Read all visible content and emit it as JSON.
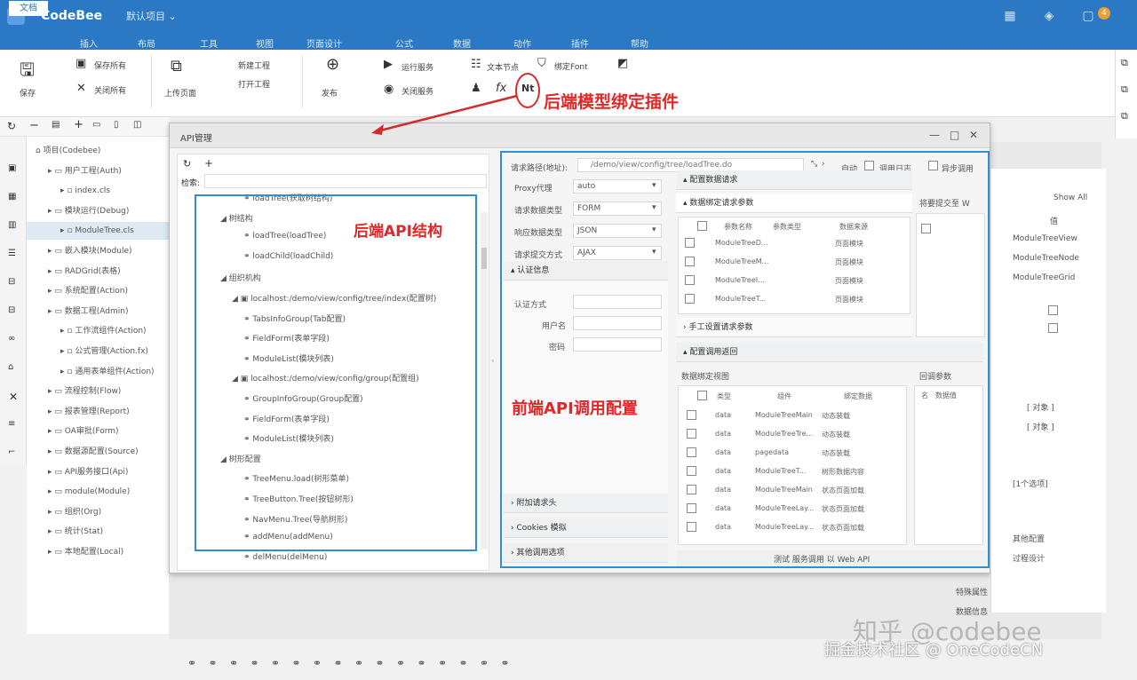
{
  "window": {
    "title": "CodeBee",
    "file_tab": "默认项目 ⌄",
    "notification_count": "4"
  },
  "menu": [
    "文档",
    "插入",
    "布局",
    "工具",
    "视图",
    "页面设计",
    "公式",
    "数据",
    "动作",
    "插件",
    "帮助"
  ],
  "ribbon": {
    "save": "保存",
    "save_all": "保存所有",
    "close_all": "关闭所有",
    "upload": "上传页面",
    "new_project": "新建工程",
    "open_project": "打开工程",
    "publish": "发布",
    "run": "运行服务",
    "close_service": "关闭服务",
    "text_node": "文本节点",
    "binding_font": "绑定Font",
    "plugin_tag": "Nt"
  },
  "tree": {
    "items": [
      {
        "label": "项目(Codebee)",
        "icon": "home-icon",
        "indent": 0
      },
      {
        "label": "用户工程(Auth)",
        "icon": "user-icon",
        "indent": 1
      },
      {
        "label": "index.cls",
        "icon": "file-icon",
        "indent": 2
      },
      {
        "label": "模块运行(Debug)",
        "icon": "folder-icon",
        "indent": 1
      },
      {
        "label": "ModuleTree.cls",
        "icon": "file-icon",
        "indent": 2,
        "selected": true
      },
      {
        "label": "嵌入模块(Module)",
        "icon": "grid-icon",
        "indent": 1
      },
      {
        "label": "RADGrid(表格)",
        "icon": "folder-icon",
        "indent": 1
      },
      {
        "label": "系统配置(Action)",
        "icon": "window-icon",
        "indent": 1
      },
      {
        "label": "数据工程(Admin)",
        "icon": "db-icon",
        "indent": 1
      },
      {
        "label": "工作流组件(Action)",
        "icon": "flow-icon",
        "indent": 2
      },
      {
        "label": "公式管理(Action.fx)",
        "icon": "fx-icon",
        "indent": 2
      },
      {
        "label": "通用表单组件(Action)",
        "icon": "user-icon",
        "indent": 2
      },
      {
        "label": "流程控制(Flow)",
        "icon": "chart-icon",
        "indent": 1
      },
      {
        "label": "报表管理(Report)",
        "icon": "table-icon",
        "indent": 1
      },
      {
        "label": "OA审批(Form)",
        "icon": "form-icon",
        "indent": 1
      },
      {
        "label": "数据源配置(Source)",
        "icon": "gear-icon",
        "indent": 1
      },
      {
        "label": "API服务接口(Api)",
        "icon": "api-icon",
        "indent": 1
      },
      {
        "label": "module(Module)",
        "icon": "folder-icon",
        "indent": 1
      },
      {
        "label": "组织(Org)",
        "icon": "building-icon",
        "indent": 1
      },
      {
        "label": "统计(Stat)",
        "icon": "table-icon",
        "indent": 1
      },
      {
        "label": "本地配置(Local)",
        "icon": "gear-icon",
        "indent": 1
      }
    ]
  },
  "dialog": {
    "title": "API管理",
    "search_label": "检索:",
    "api_tree": [
      {
        "label": "loadTree(获取树结构)",
        "indent": 2
      },
      {
        "label": "树结构",
        "indent": 1
      },
      {
        "label": "loadTree(loadTree)",
        "indent": 2
      },
      {
        "label": "loadChild(loadChild)",
        "indent": 2
      },
      {
        "label": "组织机构",
        "indent": 1
      },
      {
        "label": "localhost:/demo/view/config/tree/index(配置树)",
        "indent": 1.5
      },
      {
        "label": "TabsInfoGroup(Tab配置)",
        "indent": 2
      },
      {
        "label": "FieldForm(表单字段)",
        "indent": 2
      },
      {
        "label": "ModuleList(模块列表)",
        "indent": 2
      },
      {
        "label": "localhost:/demo/view/config/group(配置组)",
        "indent": 1.5
      },
      {
        "label": "GroupInfoGroup(Group配置)",
        "indent": 2
      },
      {
        "label": "FieldForm(表单字段)",
        "indent": 2
      },
      {
        "label": "ModuleList(模块列表)",
        "indent": 2
      },
      {
        "label": "树形配置",
        "indent": 1
      },
      {
        "label": "TreeMenu.load(树形菜单)",
        "indent": 2
      },
      {
        "label": "TreeButton.Tree(按钮树形)",
        "indent": 2
      },
      {
        "label": "NavMenu.Tree(导航树形)",
        "indent": 2
      },
      {
        "label": "addMenu(addMenu)",
        "indent": 2
      },
      {
        "label": "delMenu(delMenu)",
        "indent": 2
      }
    ],
    "url_label": "请求路径(地址):",
    "url_value": "/demo/view/config/tree/loadTree.do",
    "chk_auto": "自动",
    "chk_log": "调用日志",
    "chk_async": "异步调用",
    "fields": [
      {
        "label": "Proxy代理",
        "value": "auto"
      },
      {
        "label": "请求数据类型",
        "value": "FORM"
      },
      {
        "label": "响应数据类型",
        "value": "JSON"
      },
      {
        "label": "请求提交方式",
        "value": "AJAX"
      }
    ],
    "auth_section": "认证信息",
    "auth_fields": [
      "认证方式",
      "用户名",
      "密码"
    ],
    "sec_headers": "附加请求头",
    "sec_cookies": "Cookies 模拟",
    "sec_other": "其他调用选项",
    "cfg_request": "配置数据请求",
    "bind_params": "数据绑定请求参数",
    "req_cols": [
      "参数名称",
      "参数类型",
      "数据来源"
    ],
    "req_rows": [
      {
        "name": "ModuleTreeD...",
        "src": "页面模块"
      },
      {
        "name": "ModuleTreeM...",
        "src": "页面模块"
      },
      {
        "name": "ModuleTreeI...",
        "src": "页面模块"
      },
      {
        "name": "ModuleTreeT...",
        "src": "页面模块"
      }
    ],
    "manual_params": "手工设置请求参数",
    "submit_to": "将要提交至 W",
    "cfg_response": "配置调用返回",
    "bind_data": "数据绑定视图",
    "return_params": "回调参数",
    "resp_cols": [
      "类型",
      "组件",
      "绑定数据"
    ],
    "resp_rows": [
      {
        "t": "data",
        "c": "ModuleTreeMain",
        "b": "动态装载"
      },
      {
        "t": "data",
        "c": "ModuleTreeTre...",
        "b": "动态装载"
      },
      {
        "t": "data",
        "c": "pagedata",
        "b": "动态装载"
      },
      {
        "t": "data",
        "c": "ModuleTreeT...",
        "b": "树形数据内容"
      },
      {
        "t": "data",
        "c": "ModuleTreeMain",
        "b": "状态页面加载"
      },
      {
        "t": "data",
        "c": "ModuleTreeLay...",
        "b": "状态页面加载"
      },
      {
        "t": "data",
        "c": "ModuleTreeLay...",
        "b": "状态页面加载"
      }
    ],
    "return_cols": [
      "名",
      "数据值"
    ],
    "footer": "测试 服务调用 以 Web API"
  },
  "right_panel": {
    "label": "Show All",
    "col": "值",
    "rows": [
      "ModuleTreeView",
      "ModuleTreeNode",
      "ModuleTreeGrid"
    ],
    "btn1": "[ 对象 ]",
    "btn2": "[ 对象 ]",
    "items": [
      "[1个选项]",
      "其他配置",
      "过程设计",
      "特殊属性",
      "数据信息"
    ]
  },
  "annotations": {
    "plugin": "后端模型绑定插件",
    "back_api": "后端API结构",
    "front_api": "前端API调用配置"
  },
  "watermark": {
    "zhihu": "知乎 @codebee",
    "juejin": "掘金技术社区 @ OneCodeCN"
  }
}
